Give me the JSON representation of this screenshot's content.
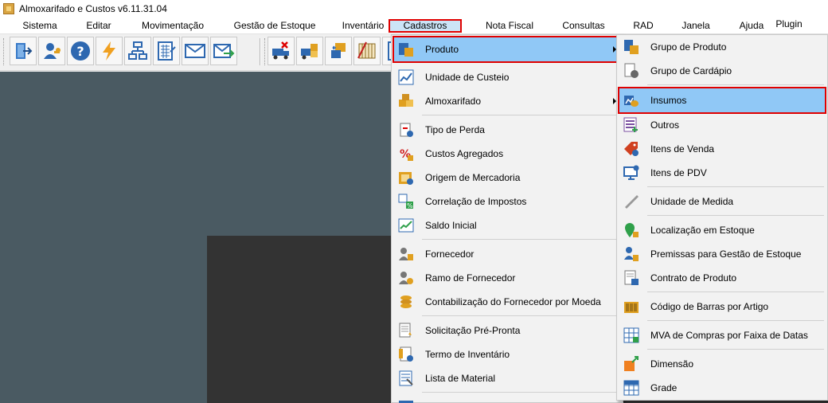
{
  "window": {
    "title": "Almoxarifado e Custos v6.11.31.04"
  },
  "menubar": {
    "items": [
      {
        "label": "Sistema"
      },
      {
        "label": "Editar"
      },
      {
        "label": "Movimentação"
      },
      {
        "label": "Gestão de Estoque"
      },
      {
        "label": "Inventário"
      },
      {
        "label": "Cadastros"
      },
      {
        "label": "Nota Fiscal"
      },
      {
        "label": "Consultas"
      },
      {
        "label": "RAD"
      },
      {
        "label": "Janela"
      },
      {
        "label": "Ajuda"
      },
      {
        "label": "Plugin"
      }
    ]
  },
  "toolbar": {
    "buttons": [
      {
        "icon": "exit-door-icon"
      },
      {
        "icon": "user-key-icon"
      },
      {
        "icon": "help-icon"
      },
      {
        "icon": "lightning-icon"
      },
      {
        "icon": "org-chart-icon"
      },
      {
        "icon": "calculator-form-icon"
      },
      {
        "icon": "envelope-icon"
      },
      {
        "icon": "envelope-arrow-icon"
      },
      {
        "icon": "truck-remove-icon"
      },
      {
        "icon": "truck-box-icon"
      },
      {
        "icon": "transfer-icon"
      },
      {
        "icon": "inventory-icon"
      },
      {
        "icon": "document-grid-icon"
      },
      {
        "icon": "chart-report-icon"
      }
    ]
  },
  "cadastros_menu": {
    "items": [
      {
        "label": "Produto",
        "icon": "product-icon",
        "submenu": true
      },
      {
        "label": "Unidade de Custeio",
        "icon": "cost-unit-icon"
      },
      {
        "label": "Almoxarifado",
        "icon": "warehouse-icon",
        "submenu": true
      },
      {
        "label": "Tipo de Perda",
        "icon": "loss-type-icon"
      },
      {
        "label": "Custos Agregados",
        "icon": "percent-icon"
      },
      {
        "label": "Origem de Mercadoria",
        "icon": "goods-origin-icon"
      },
      {
        "label": "Correlação de Impostos",
        "icon": "tax-correlation-icon"
      },
      {
        "label": "Saldo Inicial",
        "icon": "initial-balance-icon"
      },
      {
        "label": "Fornecedor",
        "icon": "supplier-icon"
      },
      {
        "label": "Ramo de Fornecedor",
        "icon": "supplier-branch-icon"
      },
      {
        "label": "Contabilização do Fornecedor por Moeda",
        "icon": "coins-icon"
      },
      {
        "label": "Solicitação Pré-Pronta",
        "icon": "request-icon"
      },
      {
        "label": "Termo de Inventário",
        "icon": "inventory-term-icon"
      },
      {
        "label": "Lista de Material",
        "icon": "material-list-icon"
      },
      {
        "label": "",
        "icon": "partial-item-icon"
      }
    ]
  },
  "produto_submenu": {
    "items": [
      {
        "label": "Grupo de Produto",
        "icon": "product-group-icon"
      },
      {
        "label": "Grupo de Cardápio",
        "icon": "menu-group-icon"
      },
      {
        "label": "Insumos",
        "icon": "supplies-icon"
      },
      {
        "label": "Outros",
        "icon": "others-icon"
      },
      {
        "label": "Itens de Venda",
        "icon": "sale-tag-icon"
      },
      {
        "label": "Itens de PDV",
        "icon": "pos-icon"
      },
      {
        "label": "Unidade de Medida",
        "icon": "ruler-icon"
      },
      {
        "label": "Localização em Estoque",
        "icon": "location-pin-icon"
      },
      {
        "label": "Premissas para Gestão de Estoque",
        "icon": "stock-premises-icon"
      },
      {
        "label": "Contrato de Produto",
        "icon": "contract-icon"
      },
      {
        "label": "Código de Barras por Artigo",
        "icon": "barcode-icon"
      },
      {
        "label": "MVA de Compras por Faixa de Datas",
        "icon": "mva-icon"
      },
      {
        "label": "Dimensão",
        "icon": "dimension-icon"
      },
      {
        "label": "Grade",
        "icon": "grid-icon"
      }
    ]
  }
}
